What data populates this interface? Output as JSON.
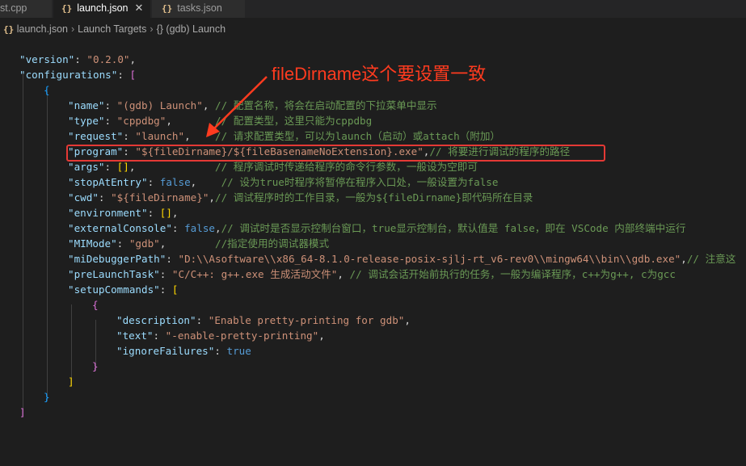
{
  "tabs": [
    {
      "label": "st.cpp",
      "icon": "",
      "active": false
    },
    {
      "label": "launch.json",
      "icon": "{}",
      "active": true,
      "close": "✕"
    },
    {
      "label": "tasks.json",
      "icon": "{}",
      "active": false
    }
  ],
  "breadcrumb": {
    "icon": "{}",
    "items": [
      "launch.json",
      "Launch Targets",
      "{} (gdb) Launch"
    ],
    "separator": "›"
  },
  "annotation": {
    "text": "fileDirname这个要设置一致",
    "color": "#ff3b1f"
  },
  "code": {
    "lines": [
      [
        [
          "k",
          "\"version\""
        ],
        [
          "p",
          ": "
        ],
        [
          "s",
          "\"0.2.0\""
        ],
        [
          "p",
          ","
        ]
      ],
      [
        [
          "k",
          "\"configurations\""
        ],
        [
          "p",
          ": "
        ],
        [
          "br2",
          "["
        ]
      ],
      [
        [
          "br3",
          "{"
        ]
      ],
      [
        [
          "k",
          "\"name\""
        ],
        [
          "p",
          ": "
        ],
        [
          "s",
          "\"(gdb) Launch\""
        ],
        [
          "p",
          ", "
        ],
        [
          "c",
          "// 配置名称，将会在启动配置的下拉菜单中显示"
        ]
      ],
      [
        [
          "k",
          "\"type\""
        ],
        [
          "p",
          ": "
        ],
        [
          "s",
          "\"cppdbg\""
        ],
        [
          "p",
          ",       "
        ],
        [
          "c",
          "// 配置类型，这里只能为cppdbg"
        ]
      ],
      [
        [
          "k",
          "\"request\""
        ],
        [
          "p",
          ": "
        ],
        [
          "s",
          "\"launch\""
        ],
        [
          "p",
          ",    "
        ],
        [
          "c",
          "// 请求配置类型，可以为launch（启动）或attach（附加）"
        ]
      ],
      [
        [
          "k",
          "\"program\""
        ],
        [
          "p",
          ": "
        ],
        [
          "s",
          "\"${fileDirname}/${fileBasenameNoExtension}.exe\""
        ],
        [
          "p",
          ","
        ],
        [
          "c",
          "// 将要进行调试的程序的路径"
        ]
      ],
      [
        [
          "k",
          "\"args\""
        ],
        [
          "p",
          ": "
        ],
        [
          "br1",
          "[]"
        ],
        [
          "p",
          ",             "
        ],
        [
          "c",
          "// 程序调试时传递给程序的命令行参数，一般设为空即可"
        ]
      ],
      [
        [
          "k",
          "\"stopAtEntry\""
        ],
        [
          "p",
          ": "
        ],
        [
          "b",
          "false"
        ],
        [
          "p",
          ",    "
        ],
        [
          "c",
          "// 设为true时程序将暂停在程序入口处，一般设置为false"
        ]
      ],
      [
        [
          "k",
          "\"cwd\""
        ],
        [
          "p",
          ": "
        ],
        [
          "s",
          "\"${fileDirname}\""
        ],
        [
          "p",
          ","
        ],
        [
          "c",
          "// 调试程序时的工作目录，一般为${fileDirname}即代码所在目录"
        ]
      ],
      [
        [
          "k",
          "\"environment\""
        ],
        [
          "p",
          ": "
        ],
        [
          "br1",
          "[]"
        ],
        [
          "p",
          ","
        ]
      ],
      [
        [
          "k",
          "\"externalConsole\""
        ],
        [
          "p",
          ": "
        ],
        [
          "b",
          "false"
        ],
        [
          "p",
          ","
        ],
        [
          "c",
          "// 调试时是否显示控制台窗口，true显示控制台，默认值是 false，即在 VSCode 内部终端中运行"
        ]
      ],
      [
        [
          "k",
          "\"MIMode\""
        ],
        [
          "p",
          ": "
        ],
        [
          "s",
          "\"gdb\""
        ],
        [
          "p",
          ",        "
        ],
        [
          "c",
          "//指定使用的调试器模式"
        ]
      ],
      [
        [
          "k",
          "\"miDebuggerPath\""
        ],
        [
          "p",
          ": "
        ],
        [
          "s",
          "\"D:\\\\Asoftware\\\\x86_64-8.1.0-release-posix-sjlj-rt_v6-rev0\\\\mingw64\\\\bin\\\\gdb.exe\""
        ],
        [
          "p",
          ","
        ],
        [
          "c",
          "// 注意这"
        ]
      ],
      [
        [
          "k",
          "\"preLaunchTask\""
        ],
        [
          "p",
          ": "
        ],
        [
          "s",
          "\"C/C++: g++.exe 生成活动文件\""
        ],
        [
          "p",
          ", "
        ],
        [
          "c",
          "// 调试会话开始前执行的任务，一般为编译程序，c++为g++, c为gcc"
        ]
      ],
      [
        [
          "k",
          "\"setupCommands\""
        ],
        [
          "p",
          ": "
        ],
        [
          "br1",
          "["
        ]
      ],
      [
        [
          "br2",
          "{"
        ]
      ],
      [
        [
          "k",
          "\"description\""
        ],
        [
          "p",
          ": "
        ],
        [
          "s",
          "\"Enable pretty-printing for gdb\""
        ],
        [
          "p",
          ","
        ]
      ],
      [
        [
          "k",
          "\"text\""
        ],
        [
          "p",
          ": "
        ],
        [
          "s",
          "\"-enable-pretty-printing\""
        ],
        [
          "p",
          ","
        ]
      ],
      [
        [
          "k",
          "\"ignoreFailures\""
        ],
        [
          "p",
          ": "
        ],
        [
          "b",
          "true"
        ]
      ],
      [
        [
          "br2",
          "}"
        ]
      ],
      [
        [
          "br1",
          "]"
        ]
      ],
      [
        [
          "br3",
          "}"
        ]
      ],
      [
        [
          "br2",
          "]"
        ]
      ]
    ]
  }
}
